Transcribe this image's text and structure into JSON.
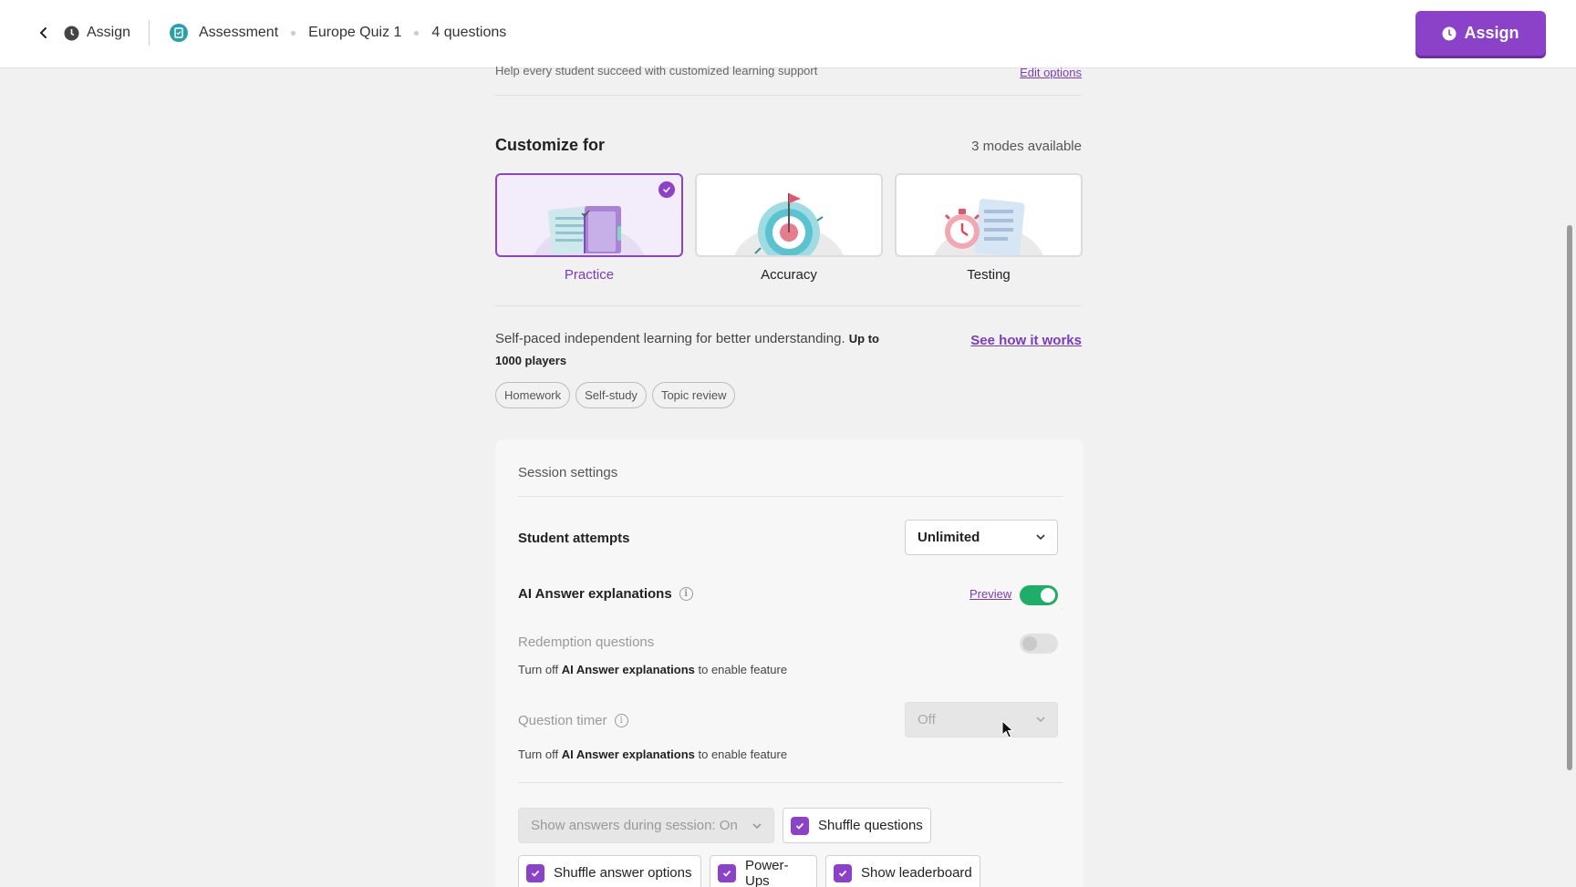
{
  "header": {
    "back_icon": "chevron-left-icon",
    "assign_crumb": "Assign",
    "assessment": "Assessment",
    "quiz_name": "Europe Quiz 1",
    "question_count": "4 questions",
    "assign_button": "Assign"
  },
  "intro": {
    "help_text": "Help every student succeed with customized learning support",
    "edit_options": "Edit options"
  },
  "customize": {
    "title": "Customize for",
    "modes_available": "3 modes available",
    "modes": [
      {
        "label": "Practice",
        "selected": true
      },
      {
        "label": "Accuracy",
        "selected": false
      },
      {
        "label": "Testing",
        "selected": false
      }
    ],
    "description": "Self-paced independent learning for better understanding.",
    "players": "Up to 1000 players",
    "see_how": "See how it works",
    "tags": [
      "Homework",
      "Self-study",
      "Topic review"
    ]
  },
  "session": {
    "title": "Session settings",
    "student_attempts": {
      "label": "Student attempts",
      "value": "Unlimited"
    },
    "ai_explanations": {
      "label": "AI Answer explanations",
      "preview": "Preview",
      "enabled": true
    },
    "redemption": {
      "label": "Redemption questions",
      "enabled": false
    },
    "redemption_note": {
      "prefix": "Turn off",
      "bold": "AI Answer explanations",
      "suffix": "to enable feature"
    },
    "question_timer": {
      "label": "Question timer",
      "value": "Off"
    },
    "timer_note": {
      "prefix": "Turn off",
      "bold": "AI Answer explanations",
      "suffix": "to enable feature"
    },
    "show_answers": "Show answers during session: On",
    "options": {
      "shuffle_questions": "Shuffle questions",
      "shuffle_answers": "Shuffle answer options",
      "power_ups": "Power-Ups",
      "leaderboard": "Show leaderboard"
    }
  },
  "colors": {
    "accent": "#8c41c9",
    "toggle_on": "#1fae68",
    "teal": "#2e9fa8"
  }
}
